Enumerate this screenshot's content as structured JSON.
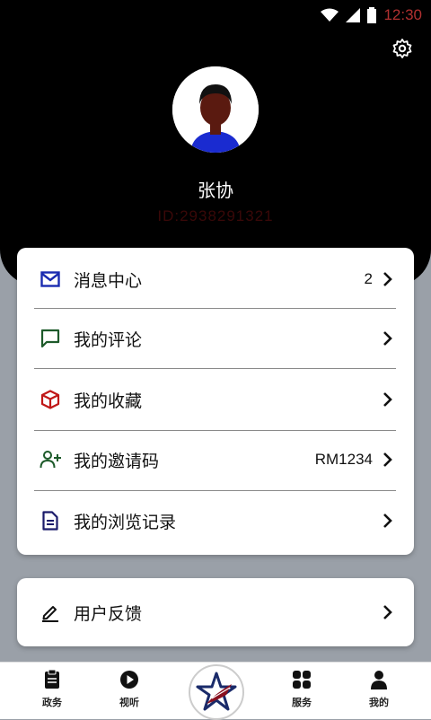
{
  "status": {
    "time": "12:30"
  },
  "profile": {
    "name": "张协",
    "id": "ID:2938291321"
  },
  "menu": [
    {
      "label": "消息中心",
      "value": "2",
      "icon": "mail-icon"
    },
    {
      "label": "我的评论",
      "value": "",
      "icon": "comment-icon"
    },
    {
      "label": "我的收藏",
      "value": "",
      "icon": "box-icon"
    },
    {
      "label": "我的邀请码",
      "value": "RM1234",
      "icon": "add-user-icon"
    },
    {
      "label": "我的浏览记录",
      "value": "",
      "icon": "document-icon"
    }
  ],
  "feedback": {
    "label": "用户反馈",
    "icon": "pencil-icon"
  },
  "tabs": [
    {
      "label": "政务",
      "icon": "clipboard-icon"
    },
    {
      "label": "视听",
      "icon": "play-icon"
    },
    {
      "label": "",
      "icon": "logo-icon"
    },
    {
      "label": "服务",
      "icon": "grid-icon"
    },
    {
      "label": "我的",
      "icon": "person-icon"
    }
  ],
  "colors": {
    "mail": "#1a2bb0",
    "comment": "#1d5a2a",
    "box": "#c01818",
    "adduser": "#1d5a2a",
    "doc": "#1a1a6a",
    "header": "#000000"
  }
}
